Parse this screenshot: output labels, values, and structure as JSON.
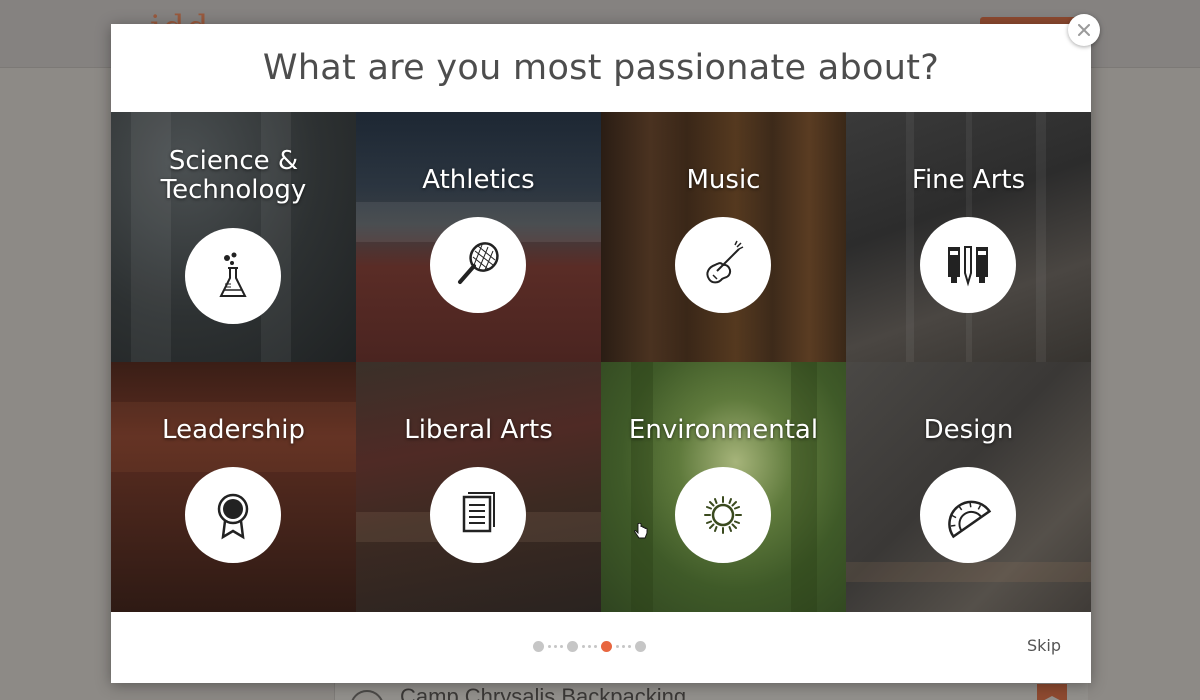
{
  "modal": {
    "title": "What are you most passionate about?",
    "skip_label": "Skip",
    "pager": {
      "total": 4,
      "active_index": 2,
      "active_color": "#e8663f"
    }
  },
  "categories": [
    {
      "label": "Science &\nTechnology",
      "icon": "flask-icon"
    },
    {
      "label": "Athletics",
      "icon": "tennis-racket-icon"
    },
    {
      "label": "Music",
      "icon": "violin-icon"
    },
    {
      "label": "Fine Arts",
      "icon": "paint-tubes-icon"
    },
    {
      "label": "Leadership",
      "icon": "award-ribbon-icon"
    },
    {
      "label": "Liberal Arts",
      "icon": "document-icon"
    },
    {
      "label": "Environmental",
      "icon": "sun-icon"
    },
    {
      "label": "Design",
      "icon": "protractor-icon"
    }
  ],
  "background": {
    "list_item_title": "Camp Chrysalis Backpacking"
  }
}
